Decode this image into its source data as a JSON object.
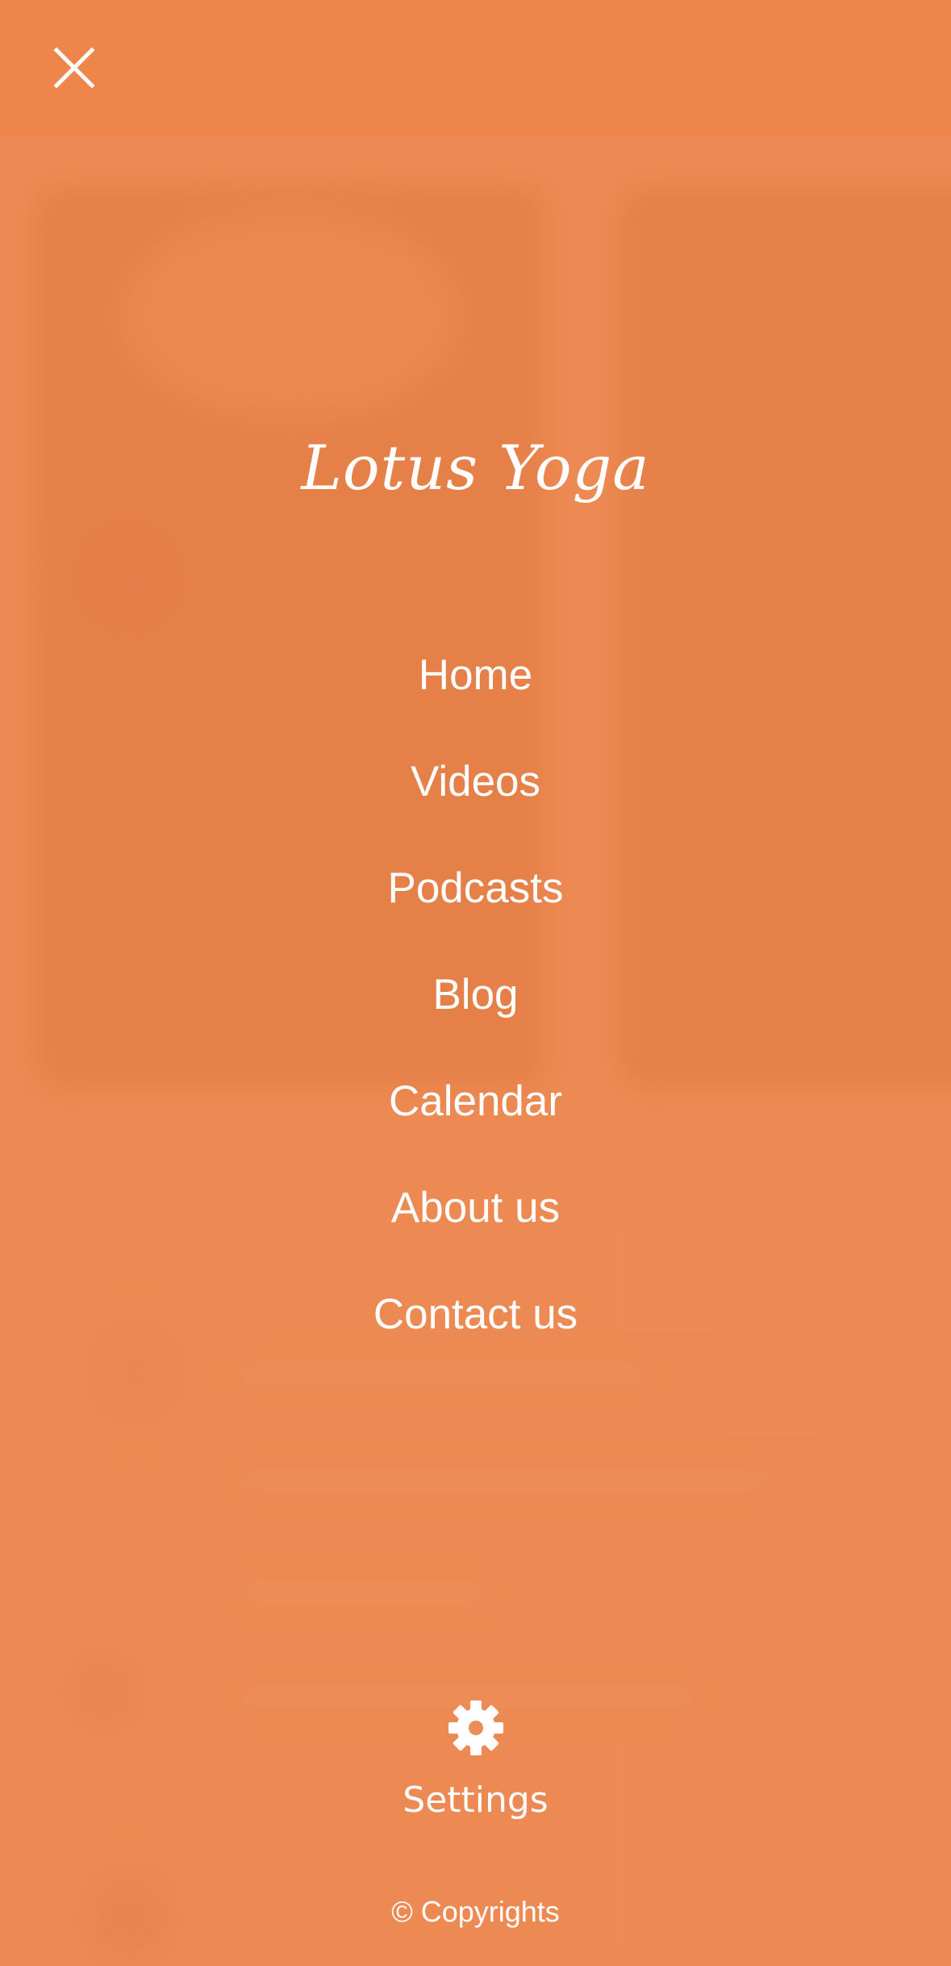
{
  "menu": {
    "close_icon": "close-icon",
    "brand": "Lotus Yoga",
    "items": [
      {
        "label": "Home"
      },
      {
        "label": "Videos"
      },
      {
        "label": "Podcasts"
      },
      {
        "label": "Blog"
      },
      {
        "label": "Calendar"
      },
      {
        "label": "About us"
      },
      {
        "label": "Contact us"
      }
    ],
    "settings": {
      "icon": "gear-icon",
      "label": "Settings"
    },
    "copyright": "© Copyrights"
  },
  "colors": {
    "background": "#ec8c57",
    "top_bar": "#ed8346",
    "text": "#ffffff"
  }
}
